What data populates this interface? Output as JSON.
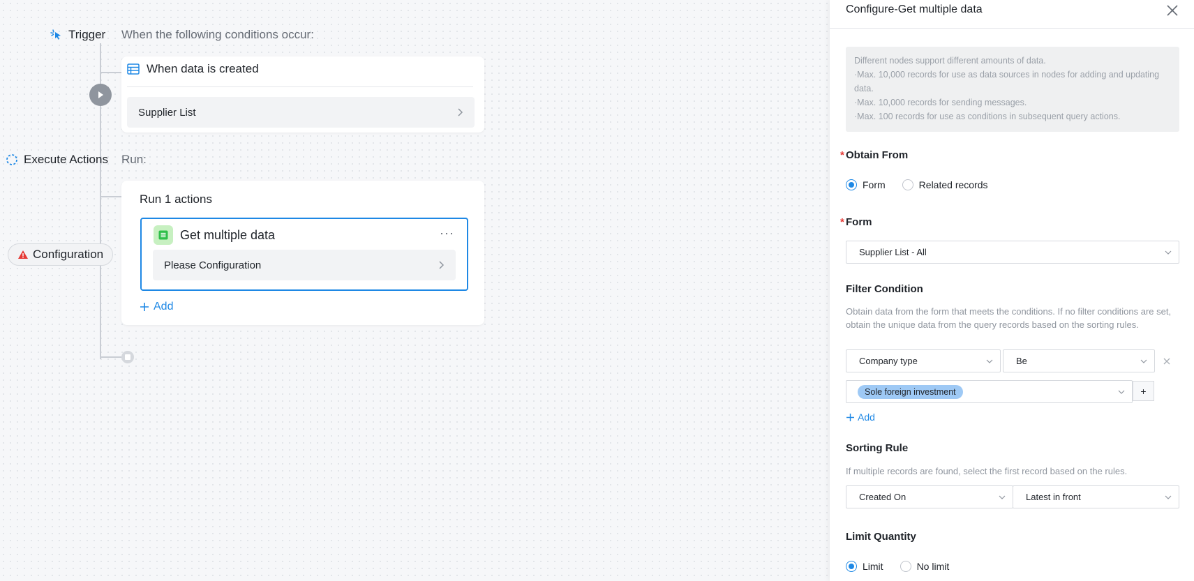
{
  "flow": {
    "trigger_label": "Trigger",
    "trigger_sub": "When the following conditions occur:",
    "trigger_card_title": "When data is created",
    "trigger_card_select": "Supplier List",
    "execute_label": "Execute Actions",
    "execute_sub": "Run:",
    "action_card_title": "Run 1 actions",
    "action_item_title": "Get multiple data",
    "action_item_more": "···",
    "action_item_select": "Please Configuration",
    "add_label": "Add",
    "config_badge": "Configuration"
  },
  "panel": {
    "title": "Configure-Get multiple data",
    "info_lines": [
      "Different nodes support different amounts of data.",
      "·Max. 10,000 records for use as data sources in nodes for adding and updating data.",
      "·Max. 10,000 records for sending messages.",
      "·Max. 100 records for use as conditions in subsequent query actions."
    ],
    "obtain_from": {
      "label": "Obtain From",
      "options": [
        "Form",
        "Related records"
      ],
      "selected": "Form"
    },
    "form": {
      "label": "Form",
      "value": "Supplier List - All"
    },
    "filter": {
      "label": "Filter Condition",
      "description": "Obtain data from the form that meets the conditions. If no filter conditions are set, obtain the unique data from the query records based on the sorting rules.",
      "field": "Company type",
      "operator": "Be",
      "value_tag": "Sole foreign investment",
      "plus": "+",
      "add_label": "Add"
    },
    "sorting": {
      "label": "Sorting Rule",
      "description": "If multiple records are found, select the first record based on the rules.",
      "field": "Created On",
      "order": "Latest in front"
    },
    "limit": {
      "label": "Limit Quantity",
      "options": [
        "Limit",
        "No limit"
      ],
      "selected": "Limit"
    }
  },
  "colors": {
    "accent": "#1e88e5",
    "warning": "#e53935",
    "success_bg": "#c7f0c1"
  }
}
